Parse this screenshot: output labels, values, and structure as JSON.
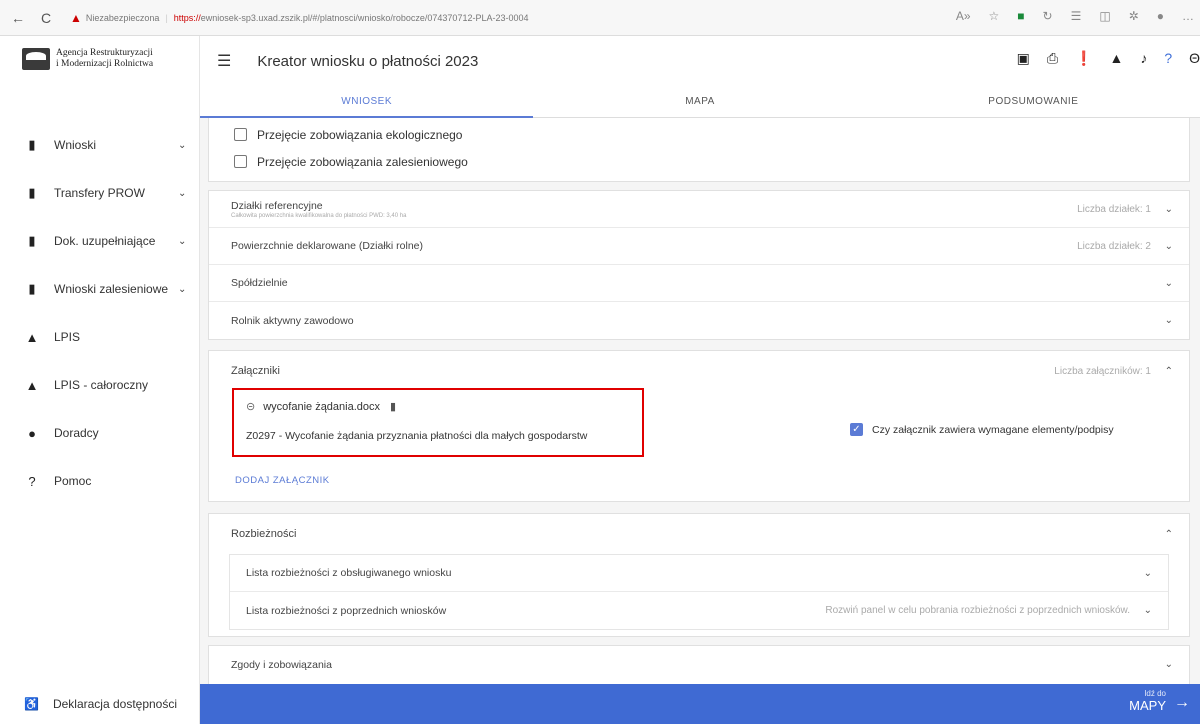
{
  "browser": {
    "back": "←",
    "reload": "C",
    "security_label": "Niezabezpieczona",
    "url_scheme": "https://",
    "url_rest": "ewniosek-sp3.uxad.zszik.pl/#/platnosci/wniosko/robocze/074370712-PLA-23-0004"
  },
  "sidebar": {
    "logo_line1": "Agencja Restrukturyzacji",
    "logo_line2": "i Modernizacji Rolnictwa",
    "items": [
      {
        "label": "Wnioski",
        "icon": "clipboard-icon",
        "has_chevron": true
      },
      {
        "label": "Transfery PROW",
        "icon": "clipboard-icon",
        "has_chevron": true
      },
      {
        "label": "Dok. uzupełniające",
        "icon": "clipboard-icon",
        "has_chevron": true
      },
      {
        "label": "Wnioski zalesieniowe",
        "icon": "clipboard-icon",
        "has_chevron": true
      },
      {
        "label": "LPIS",
        "icon": "mountain-icon",
        "has_chevron": false
      },
      {
        "label": "LPIS - całoroczny",
        "icon": "mountain-icon",
        "has_chevron": false
      },
      {
        "label": "Doradcy",
        "icon": "person-icon",
        "has_chevron": false
      },
      {
        "label": "Pomoc",
        "icon": "help-icon",
        "has_chevron": false
      }
    ],
    "accessibility": "Deklaracja dostępności"
  },
  "header": {
    "title": "Kreator wniosku o płatności 2023"
  },
  "tabs": [
    "WNIOSEK",
    "MAPA",
    "PODSUMOWANIE"
  ],
  "active_tab": "WNIOSEK",
  "checkboxes": [
    "Przejęcie zobowiązania ekologicznego",
    "Przejęcie zobowiązania zalesieniowego"
  ],
  "panels": {
    "dzialki": {
      "label": "Działki referencyjne",
      "sub": "Całkowita powierzchnia kwalifikowalna do płatności PWD: 3,40 ha",
      "right": "Liczba działek: 1"
    },
    "powierzchnie": {
      "label": "Powierzchnie deklarowane (Działki rolne)",
      "right": "Liczba działek: 2"
    },
    "spoldzielnie": {
      "label": "Spółdzielnie"
    },
    "rolnik": {
      "label": "Rolnik aktywny zawodowo"
    }
  },
  "attachments": {
    "title": "Załączniki",
    "count": "Liczba załączników: 1",
    "file_name": "wycofanie żądania.docx",
    "description": "Z0297 - Wycofanie żądania przyznania płatności dla małych gospodarstw",
    "checkbox_label": "Czy załącznik zawiera wymagane elementy/podpisy",
    "add_button": "DODAJ ZAŁĄCZNIK"
  },
  "rozbieznosci": {
    "title": "Rozbieżności",
    "rows": [
      {
        "label": "Lista rozbieżności z obsługiwanego wniosku",
        "right": ""
      },
      {
        "label": "Lista rozbieżności z poprzednich wniosków",
        "right": "Rozwiń panel w celu pobrania rozbieżności z poprzednich wniosków."
      }
    ]
  },
  "zgody": {
    "label": "Zgody i zobowiązania"
  },
  "bottombar": {
    "small": "Idź do",
    "big": "MAPY"
  },
  "colors": {
    "accent": "#3f6ad3",
    "highlight": "#e00000"
  }
}
